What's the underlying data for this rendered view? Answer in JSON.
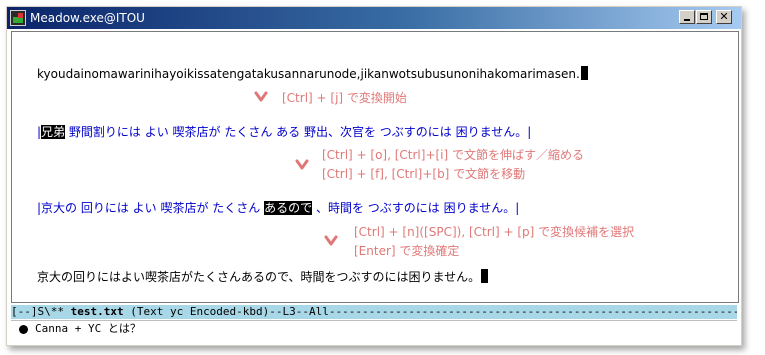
{
  "window": {
    "title": "Meadow.exe@ITOU"
  },
  "editor": {
    "romaji_line": "kyoudainomawarinihayoikissatengatakusannarunode,jikanwotsubusunonihakomarimasen.",
    "segment1": {
      "open_bar": "|",
      "highlight": "兄弟",
      "rest": " 野間割りには よい 喫茶店が たくさん ある 野出、次官を つぶすのには 困りません。|"
    },
    "segment2": {
      "before": "|京大の 回りには よい 喫茶店が たくさん ",
      "highlight": "あるので",
      "after": " 、時間を つぶすのには 困りません。|"
    },
    "final_line": "京大の回りにはよい喫茶店がたくさんあるので、時間をつぶすのには困りません。"
  },
  "notes": {
    "n1": "[Ctrl] + [j] で変換開始",
    "n2": "[Ctrl] + [o], [Ctrl]+[i] で文節を伸ばす／縮める",
    "n3": "[Ctrl] + [f], [Ctrl]+[b] で文節を移動",
    "n4": "[Ctrl] + [n]([SPC]), [Ctrl] + [p] で変換候補を選択",
    "n5": "[Enter] で変換確定"
  },
  "modeline": {
    "prefix": "[--]S\\** ",
    "buffer": "test.txt",
    "suffix": "        (Text yc Encoded-kbd)--L3--All-----------------------------------------------------------------------------"
  },
  "minibuffer": {
    "text": "Canna + YC とは？"
  },
  "colors": {
    "note": "#e07878",
    "converted_text": "#0000cc",
    "modeline_bg": "#a8d8e8",
    "title_gradient_start": "#0a246a"
  }
}
